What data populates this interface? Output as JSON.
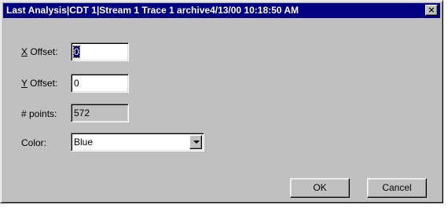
{
  "window": {
    "title": "Last Analysis|CDT 1|Stream 1 Trace 1 archive4/13/00 10:18:50 AM",
    "close_glyph": "×"
  },
  "form": {
    "x_offset": {
      "label_mnemonic": "X",
      "label_rest": " Offset:",
      "value": "0"
    },
    "y_offset": {
      "label_mnemonic": "Y",
      "label_rest": " Offset:",
      "value": "0"
    },
    "points": {
      "label": "# points:",
      "value": "572"
    },
    "color": {
      "label": "Color:",
      "value": "Blue"
    }
  },
  "buttons": {
    "ok": "OK",
    "cancel": "Cancel"
  },
  "icons": {
    "close": "close-icon",
    "dropdown": "chevron-down-icon"
  }
}
